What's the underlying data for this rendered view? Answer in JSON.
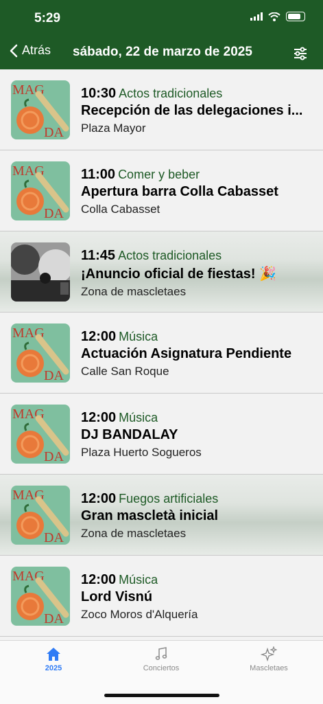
{
  "status": {
    "time": "5:29"
  },
  "header": {
    "back_label": "Atrás",
    "title": "sábado, 22 de marzo de 2025"
  },
  "events": [
    {
      "time": "10:30",
      "category": "Actos tradicionales",
      "name": "Recepción de las delegaciones i...",
      "place": "Plaza Mayor",
      "featured": false,
      "thumb": "poster"
    },
    {
      "time": "11:00",
      "category": "Comer y beber",
      "name": "Apertura barra Colla Cabasset",
      "place": "Colla Cabasset",
      "featured": false,
      "thumb": "poster"
    },
    {
      "time": "11:45",
      "category": "Actos tradicionales",
      "name": "¡Anuncio oficial de fiestas! 🎉",
      "place": "Zona de mascletaes",
      "featured": true,
      "thumb": "photo"
    },
    {
      "time": "12:00",
      "category": "Música",
      "name": "Actuación Asignatura Pendiente",
      "place": "Calle San Roque",
      "featured": false,
      "thumb": "poster"
    },
    {
      "time": "12:00",
      "category": "Música",
      "name": "DJ BANDALAY",
      "place": "Plaza Huerto Sogueros",
      "featured": false,
      "thumb": "poster"
    },
    {
      "time": "12:00",
      "category": "Fuegos artificiales",
      "name": "Gran mascletà inicial",
      "place": "Zona de mascletaes",
      "featured": true,
      "thumb": "poster"
    },
    {
      "time": "12:00",
      "category": "Música",
      "name": "Lord Visnú",
      "place": "Zoco Moros d'Alquería",
      "featured": false,
      "thumb": "poster"
    }
  ],
  "poster_text": {
    "top": "MAG",
    "bottom": "DA"
  },
  "tabs": [
    {
      "label": "2025",
      "icon": "house-icon",
      "active": true
    },
    {
      "label": "Conciertos",
      "icon": "music-note-icon",
      "active": false
    },
    {
      "label": "Mascletaes",
      "icon": "sparkles-icon",
      "active": false
    }
  ],
  "colors": {
    "header_green": "#1e5a26",
    "category_green": "#1e5a26",
    "tab_active": "#2f7bf5",
    "poster_bg": "#7fbf9f"
  }
}
